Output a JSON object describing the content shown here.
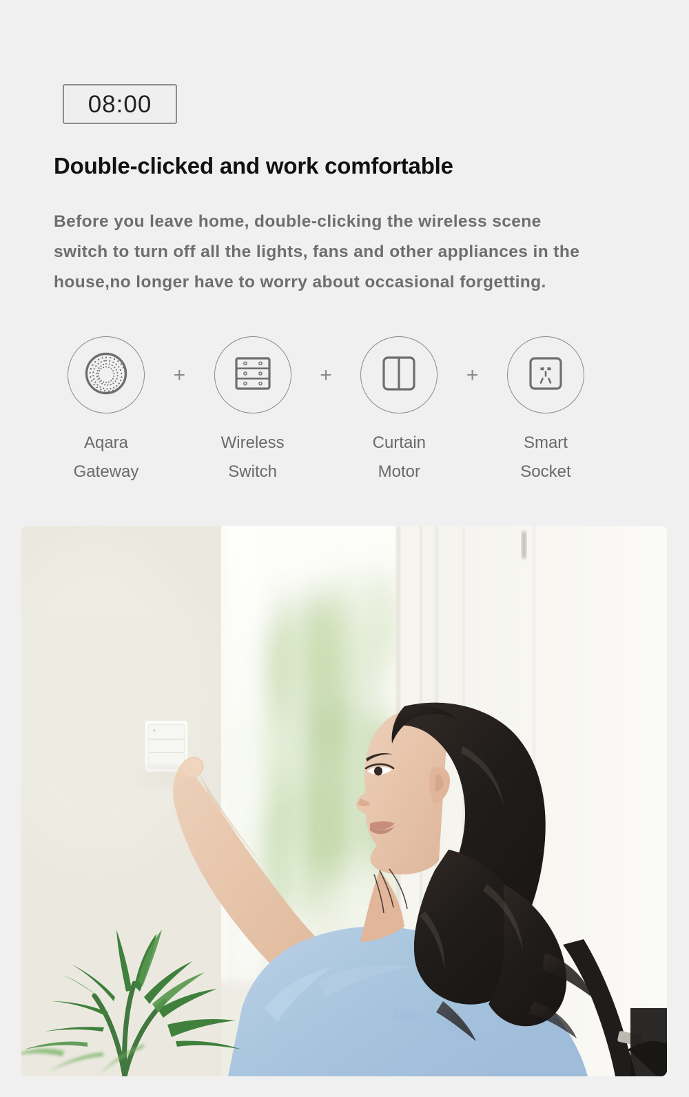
{
  "page": {
    "background_color": "#f0f0f0"
  },
  "time_badge": {
    "value": "08:00",
    "border_color": "#8c8c8c",
    "text_color": "#222222"
  },
  "heading": {
    "text": "Double-clicked and work comfortable",
    "color": "#111111"
  },
  "body": {
    "text": "Before you leave home, double-clicking the wireless scene switch to turn off all the lights, fans and other appliances in the house,no longer have to worry about occasional forgetting.",
    "color": "#6e6e6e"
  },
  "devices": {
    "separator": "+",
    "separator_color": "#8a8a8a",
    "circle_color": "#8a8a8a",
    "label_color": "#6a6a6a",
    "items": [
      {
        "icon": "aqara-gateway-icon",
        "label": "Aqara\nGateway"
      },
      {
        "icon": "wireless-switch-icon",
        "label": "Wireless\nSwitch"
      },
      {
        "icon": "curtain-motor-icon",
        "label": "Curtain\nMotor"
      },
      {
        "icon": "smart-socket-icon",
        "label": "Smart\nSocket"
      }
    ]
  },
  "photo": {
    "alt": "Woman in light blue blouse with black shoulder bag double-clicking a white wireless wall scene switch beside a bright window with green foliage and a potted palm in the foreground",
    "corner_radius": "9px",
    "colors": {
      "wall": "#eceae2",
      "window_light": "#fbfbf7",
      "foliage": "#9dbd7e",
      "blouse": "#a7c6e2",
      "hair": "#14100f",
      "skin": "#e3b89a",
      "bag": "#15110f",
      "plant": "#3f7a38"
    }
  }
}
